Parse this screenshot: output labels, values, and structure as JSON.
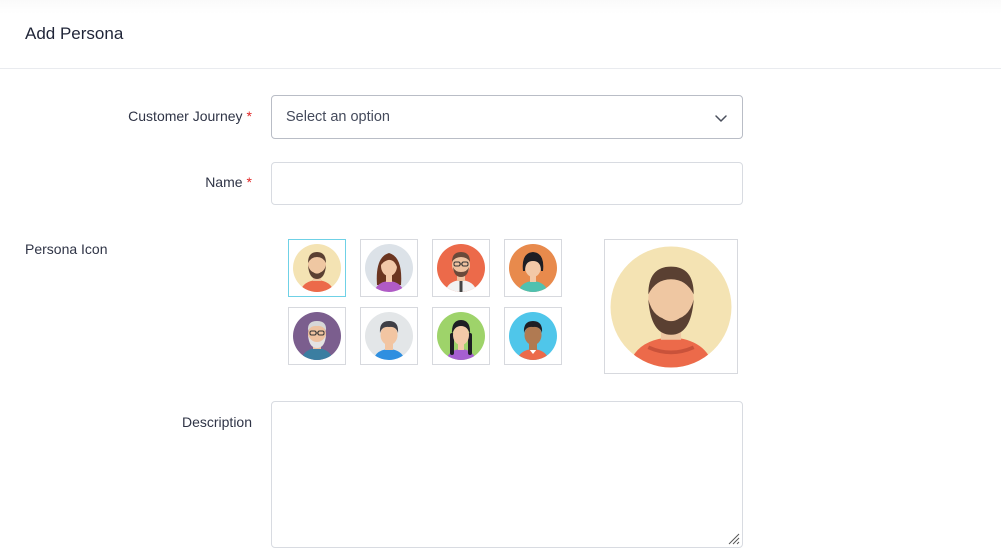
{
  "header": {
    "title": "Add Persona"
  },
  "form": {
    "customer_journey": {
      "label": "Customer Journey",
      "required_mark": "*",
      "placeholder": "Select an option"
    },
    "name": {
      "label": "Name",
      "required_mark": "*",
      "value": ""
    },
    "persona_icon": {
      "label": "Persona Icon",
      "selected_index": 0,
      "options": [
        "bearded-man-avatar-icon",
        "long-haired-woman-avatar-icon",
        "man-with-glasses-avatar-icon",
        "woman-with-bob-avatar-icon",
        "elderly-man-avatar-icon",
        "young-man-avatar-icon",
        "woman-with-braids-avatar-icon",
        "dark-skinned-man-avatar-icon"
      ]
    },
    "description": {
      "label": "Description",
      "value": ""
    }
  },
  "colors": {
    "selected_border": "#6fd1e6",
    "required": "#e02424",
    "border": "#d8dbe1"
  }
}
